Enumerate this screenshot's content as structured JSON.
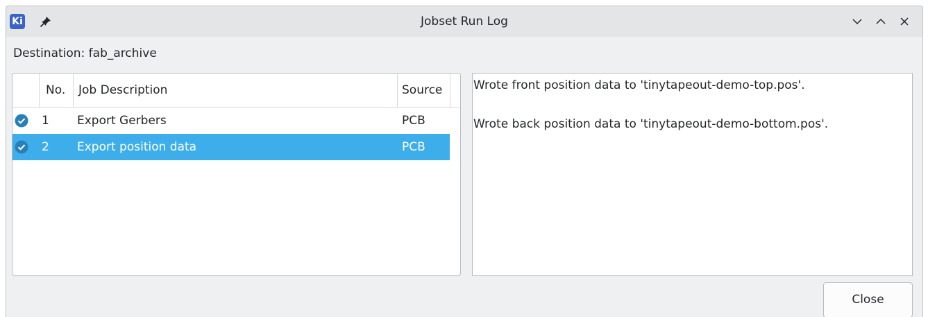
{
  "window": {
    "title": "Jobset Run Log",
    "app_icon_text": "Ki",
    "icons": [
      "pin-icon",
      "minimize-icon",
      "maximize-icon",
      "close-icon"
    ]
  },
  "destination": {
    "label": "Destination: fab_archive"
  },
  "jobs": {
    "columns": {
      "number": "No.",
      "description": "Job Description",
      "source": "Source"
    },
    "rows": [
      {
        "number": "1",
        "description": "Export Gerbers",
        "source": "PCB",
        "status_icon": "check-circle-icon",
        "selected": false
      },
      {
        "number": "2",
        "description": "Export position data",
        "source": "PCB",
        "status_icon": "check-circle-icon",
        "selected": true
      }
    ]
  },
  "log": {
    "lines": [
      "Wrote front position data to 'tinytapeout-demo-top.pos'.",
      "Wrote back position data to 'tinytapeout-demo-bottom.pos'."
    ]
  },
  "buttons": {
    "close_label": "Close"
  },
  "colors": {
    "selection": "#3daee9",
    "check": "#2980b9",
    "window_bg": "#eff0f1"
  }
}
